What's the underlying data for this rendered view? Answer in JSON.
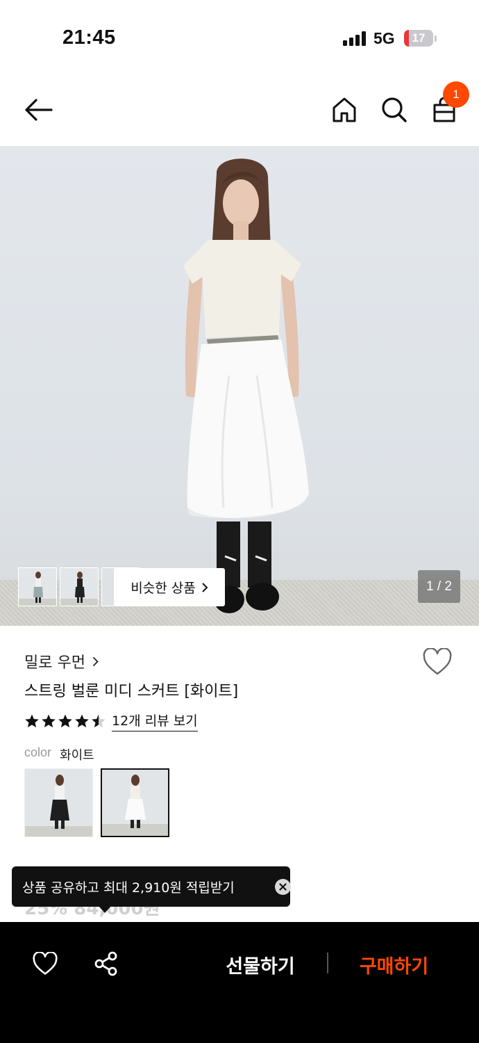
{
  "status_bar": {
    "time": "21:45",
    "network": "5G",
    "battery": "17",
    "battery_level": 0.17
  },
  "nav": {
    "back_icon": "arrow-left-icon",
    "home_icon": "home-icon",
    "search_icon": "search-icon",
    "cart_icon": "shopping-bag-icon",
    "cart_count": "1"
  },
  "gallery": {
    "similar_label": "비슷한 상품",
    "page_indicator": "1 / 2"
  },
  "product": {
    "brand": "밀로 우먼",
    "name": "스트링 벌룬 미디 스커트 [화이트]",
    "rating": 4.5,
    "review_link": "12개 리뷰 보기",
    "color_label": "color",
    "color_value": "화이트",
    "price_peek": "25% 84,000원"
  },
  "tooltip": {
    "text": "상품 공유하고 최대 2,910원 적립받기"
  },
  "bottom_bar": {
    "gift_label": "선물하기",
    "buy_label": "구매하기"
  },
  "colors": {
    "accent": "#ff4800",
    "battery_low": "#e7383c",
    "bottom_bg": "#000000"
  }
}
